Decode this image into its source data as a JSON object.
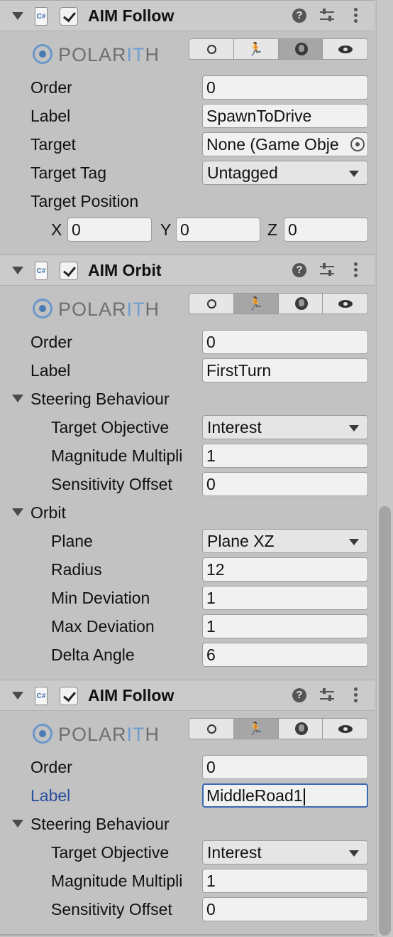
{
  "component_icon_text": "C#",
  "components": [
    {
      "title": "AIM Follow",
      "logo": {
        "text_main": "POLAR",
        "text_accent": "IT",
        "text_end": "H"
      },
      "toolbar": {
        "help_glyph": "?"
      },
      "order": {
        "label": "Order",
        "value": "0"
      },
      "label_field": {
        "label": "Label",
        "value": "SpawnToDrive"
      },
      "target": {
        "label": "Target",
        "value": "None (Game Obje"
      },
      "target_tag": {
        "label": "Target Tag",
        "value": "Untagged"
      },
      "target_position": {
        "label": "Target Position",
        "x_label": "X",
        "x": "0",
        "y_label": "Y",
        "y": "0",
        "z_label": "Z",
        "z": "0"
      }
    },
    {
      "title": "AIM Orbit",
      "order": {
        "label": "Order",
        "value": "0"
      },
      "label_field": {
        "label": "Label",
        "value": "FirstTurn"
      },
      "steering": {
        "header": "Steering Behaviour",
        "target_objective": {
          "label": "Target Objective",
          "value": "Interest"
        },
        "magnitude": {
          "label": "Magnitude Multipli",
          "value": "1"
        },
        "sensitivity": {
          "label": "Sensitivity Offset",
          "value": "0"
        }
      },
      "orbit": {
        "header": "Orbit",
        "plane": {
          "label": "Plane",
          "value": "Plane XZ"
        },
        "radius": {
          "label": "Radius",
          "value": "12"
        },
        "min_dev": {
          "label": "Min Deviation",
          "value": "1"
        },
        "max_dev": {
          "label": "Max Deviation",
          "value": "1"
        },
        "delta_angle": {
          "label": "Delta Angle",
          "value": "6"
        }
      }
    },
    {
      "title": "AIM Follow",
      "order": {
        "label": "Order",
        "value": "0"
      },
      "label_field": {
        "label": "Label",
        "value": "MiddleRoad1"
      },
      "steering": {
        "header": "Steering Behaviour",
        "target_objective": {
          "label": "Target Objective",
          "value": "Interest"
        },
        "magnitude": {
          "label": "Magnitude Multipli",
          "value": "1"
        },
        "sensitivity": {
          "label": "Sensitivity Offset",
          "value": "0"
        }
      }
    }
  ],
  "mode_buttons": [
    {
      "name": "circle-icon"
    },
    {
      "name": "run-icon",
      "glyph": "🏃"
    },
    {
      "name": "globe-icon"
    },
    {
      "name": "eye-icon"
    }
  ],
  "active_mode_per_component": [
    "globe-icon",
    "run-icon",
    "run-icon"
  ],
  "colors": {
    "focus": "#3c69b3",
    "logo_accent": "#6f9dd0",
    "label_focused": "#2a4fa0"
  }
}
